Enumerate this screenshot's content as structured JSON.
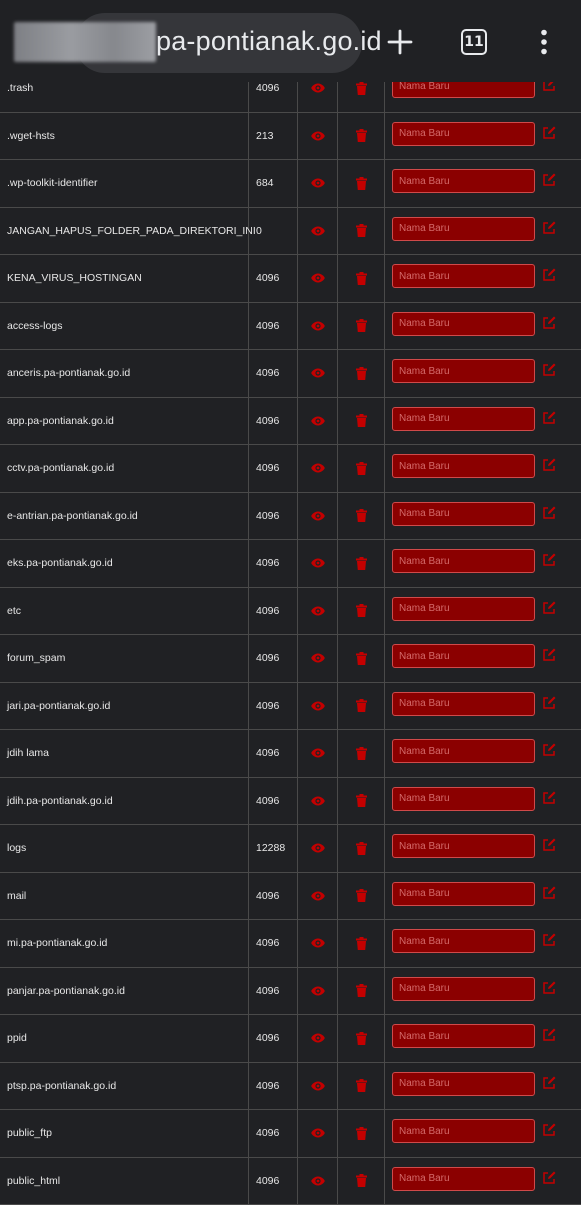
{
  "browser": {
    "url_visible": "pa-pontianak.go.id",
    "tab_count": "11",
    "icons": {
      "new_tab": "plus-icon",
      "tabs": "tab-switcher-icon",
      "menu": "kebab-menu-icon"
    }
  },
  "files": {
    "rename_placeholder": "Nama Baru",
    "accent_color": "#8b0000",
    "icon_color": "#c40000",
    "rows": [
      {
        "name": ".trash",
        "size": "4096"
      },
      {
        "name": ".wget-hsts",
        "size": "213"
      },
      {
        "name": ".wp-toolkit-identifier",
        "size": "684"
      },
      {
        "name": "JANGAN_HAPUS_FOLDER_PADA_DIREKTORI_INI",
        "size": "0"
      },
      {
        "name": "KENA_VIRUS_HOSTINGAN",
        "size": "4096"
      },
      {
        "name": "access-logs",
        "size": "4096"
      },
      {
        "name": "anceris.pa-pontianak.go.id",
        "size": "4096"
      },
      {
        "name": "app.pa-pontianak.go.id",
        "size": "4096"
      },
      {
        "name": "cctv.pa-pontianak.go.id",
        "size": "4096"
      },
      {
        "name": "e-antrian.pa-pontianak.go.id",
        "size": "4096"
      },
      {
        "name": "eks.pa-pontianak.go.id",
        "size": "4096"
      },
      {
        "name": "etc",
        "size": "4096"
      },
      {
        "name": "forum_spam",
        "size": "4096"
      },
      {
        "name": "jari.pa-pontianak.go.id",
        "size": "4096"
      },
      {
        "name": "jdih lama",
        "size": "4096"
      },
      {
        "name": "jdih.pa-pontianak.go.id",
        "size": "4096"
      },
      {
        "name": "logs",
        "size": "12288"
      },
      {
        "name": "mail",
        "size": "4096"
      },
      {
        "name": "mi.pa-pontianak.go.id",
        "size": "4096"
      },
      {
        "name": "panjar.pa-pontianak.go.id",
        "size": "4096"
      },
      {
        "name": "ppid",
        "size": "4096"
      },
      {
        "name": "ptsp.pa-pontianak.go.id",
        "size": "4096"
      },
      {
        "name": "public_ftp",
        "size": "4096"
      },
      {
        "name": "public_html",
        "size": "4096"
      }
    ]
  }
}
